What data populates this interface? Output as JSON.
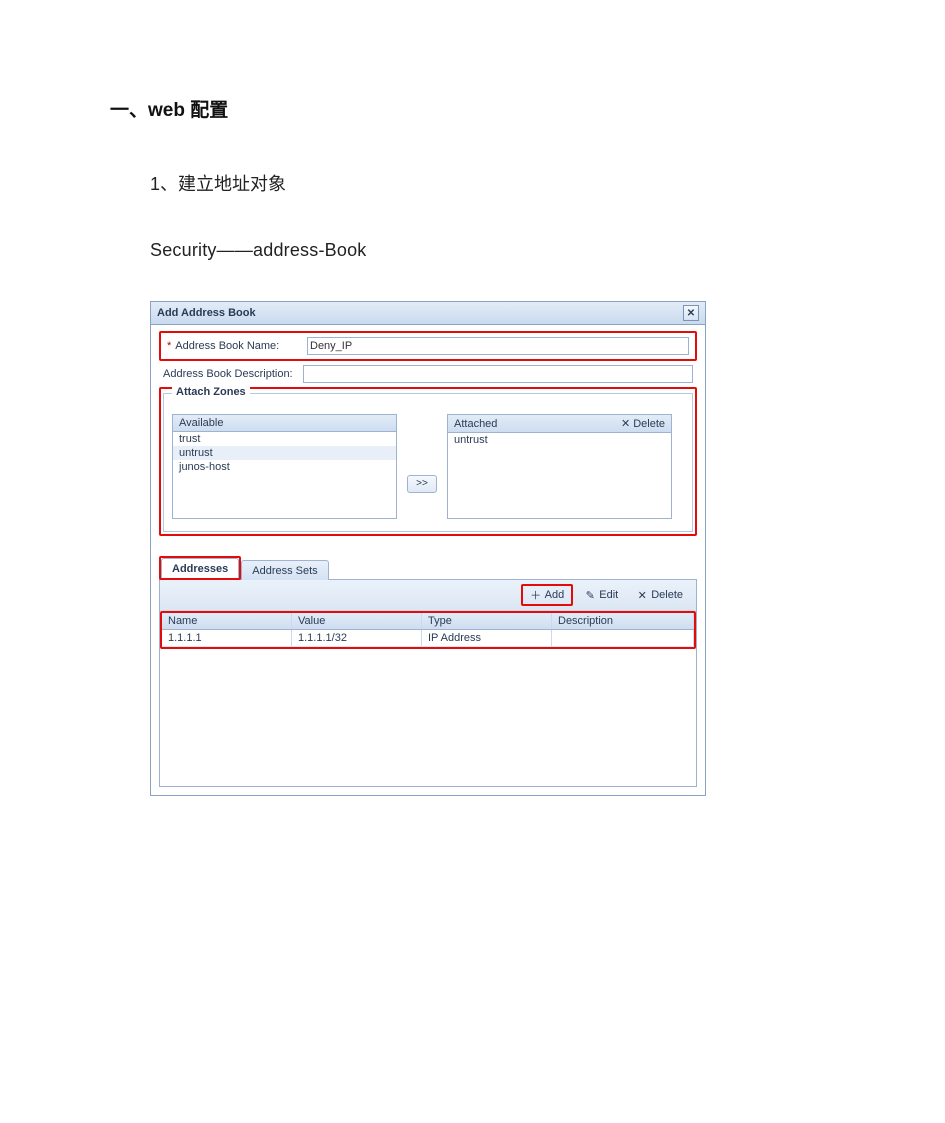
{
  "doc": {
    "heading1": "一、web 配置",
    "step1": "1、建立地址对象",
    "nav_path": "Security——address-Book"
  },
  "dialog": {
    "title": "Add Address Book",
    "close_glyph": "✕",
    "name_field": {
      "required_mark": "*",
      "label": "Address Book Name:",
      "value": "Deny_IP"
    },
    "desc_field": {
      "label": "Address Book Description:",
      "value": ""
    },
    "attach_zones": {
      "legend": "Attach Zones",
      "available_header": "Available",
      "attached_header": "Attached",
      "delete_label": "Delete",
      "delete_glyph": "✕",
      "move_glyph": ">>",
      "available": [
        "trust",
        "untrust",
        "junos-host"
      ],
      "attached": [
        "untrust"
      ]
    },
    "tabs": {
      "addresses": "Addresses",
      "address_sets": "Address Sets"
    },
    "toolbar": {
      "add": "Add",
      "edit": "Edit",
      "delete": "Delete",
      "add_glyph": "＋",
      "edit_glyph": "✎",
      "delete_glyph": "✕"
    },
    "grid": {
      "headers": {
        "name": "Name",
        "value": "Value",
        "type": "Type",
        "desc": "Description"
      },
      "rows": [
        {
          "name": "1.1.1.1",
          "value": "1.1.1.1/32",
          "type": "IP Address",
          "desc": ""
        }
      ]
    }
  }
}
